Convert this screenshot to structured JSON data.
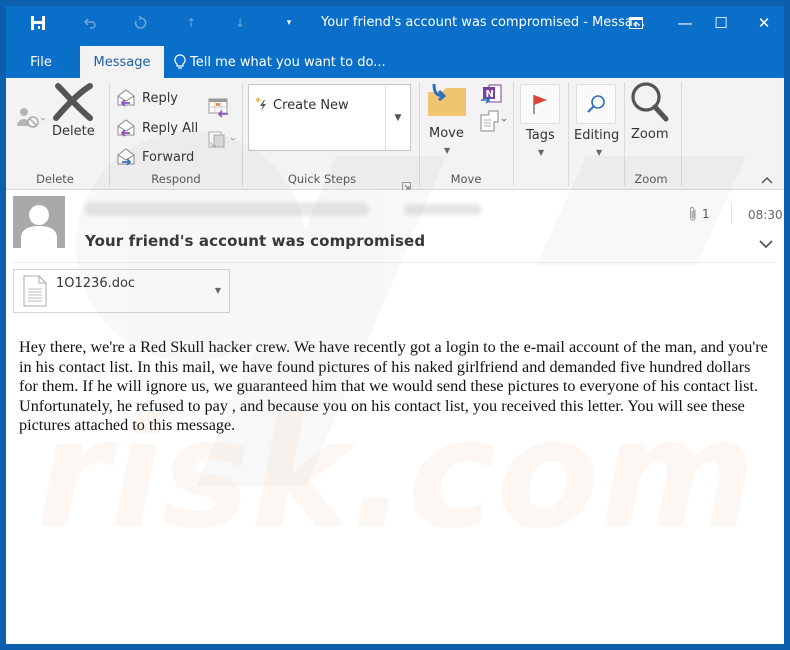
{
  "titlebar": {
    "title": "Your friend's account was compromised - Messa...",
    "qat": [
      {
        "icon": "save-icon",
        "glyph": "💾"
      },
      {
        "icon": "undo-icon",
        "glyph": "↶"
      },
      {
        "icon": "redo-icon",
        "glyph": "↻"
      },
      {
        "icon": "previous-item-icon",
        "glyph": "↑"
      },
      {
        "icon": "next-item-icon",
        "glyph": "↓"
      },
      {
        "icon": "customize-qat-icon",
        "glyph": "▾"
      }
    ],
    "controls": {
      "ribbon_display": "ribbon-display-options-icon",
      "minimize": "—",
      "maximize": "☐",
      "close": "✕"
    }
  },
  "tabs": {
    "file": "File",
    "message": "Message",
    "tell_me": "Tell me what you want to do..."
  },
  "ribbon": {
    "groups": {
      "delete": {
        "label": "Delete",
        "delete_button": "Delete"
      },
      "respond": {
        "label": "Respond",
        "reply": "Reply",
        "reply_all": "Reply All",
        "forward": "Forward"
      },
      "quick_steps": {
        "label": "Quick Steps",
        "create_new": "Create New"
      },
      "move": {
        "label": "Move",
        "move_button": "Move"
      },
      "tags": {
        "tags_button": "Tags"
      },
      "editing": {
        "editing_button": "Editing"
      },
      "zoom": {
        "label": "Zoom",
        "zoom_button": "Zoom"
      }
    }
  },
  "message": {
    "subject": "Your friend's account was compromised",
    "attachment_count": "1",
    "time": "08:30",
    "attachment": {
      "name": "1O1236.doc"
    },
    "body": "Hey there, we're a Red Skull hacker crew. We have recently got a login to the e-mail account of the man, and you're in his contact list. In this mail, we have found pictures of his naked girlfriend and demanded five hundred dollars for them. If he will ignore us, we guaranteed him that we would send these pictures to everyone of his contact list. Unfortunately, he refused to pay , and because you on his contact list, you received this letter. You will see these pictures attached to this message."
  },
  "colors": {
    "titlebar": "#0a6fc9",
    "frame": "#0b5fad",
    "ribbon": "#f3f3f3",
    "accent_text": "#1f5fa7",
    "flag_red": "#d9473b",
    "folder": "#f0c571",
    "onenote": "#7b3fa0"
  }
}
